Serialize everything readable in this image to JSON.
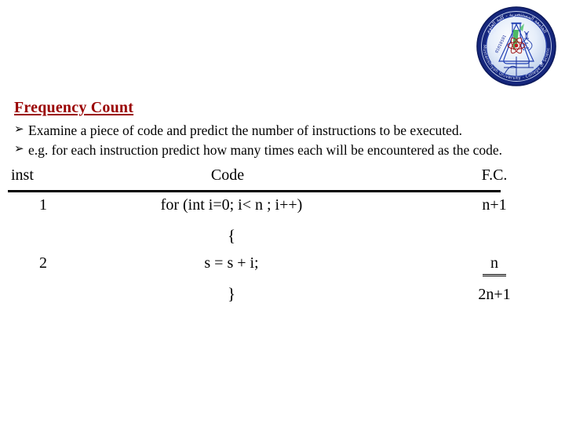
{
  "slide": {
    "heading": "Frequency Count",
    "bullets": [
      {
        "glyph": "➢",
        "glyph_name": "arrow-bullet-icon",
        "text": "Examine a piece of code and predict the number of instructions to be executed."
      },
      {
        "glyph": "➢",
        "glyph_name": "arrow-bullet-icon",
        "text": "e.g. for each instruction predict how many times each will be encountered as the code."
      }
    ],
    "heading_color": "#9a0000",
    "text_color": "#000000",
    "background_color": "#ffffff"
  },
  "table": {
    "headers": {
      "inst": "inst",
      "code": "Code",
      "fc": "F.C."
    },
    "rows": [
      {
        "inst": "1",
        "code": "for (int i=0; i< n ; i++)",
        "fc": "n+1",
        "fc_underlined": false
      },
      {
        "inst": "",
        "code": "{",
        "fc": "",
        "fc_underlined": false
      },
      {
        "inst": "2",
        "code": "s = s + i;",
        "fc": "n",
        "fc_underlined": true
      },
      {
        "inst": "",
        "code": "}",
        "fc": "2n+1",
        "fc_underlined": false
      }
    ]
  },
  "logo": {
    "name": "mustansiriyah-university-college-of-science-seal",
    "ring_color": "#1a2f8f",
    "inner_color": "#dfe9f7",
    "arabic_top": "الجامعة المستنصرية",
    "english_bottom": "Mustansiriyah University - College of Science",
    "year": "1963",
    "binary_text": "01010101"
  }
}
